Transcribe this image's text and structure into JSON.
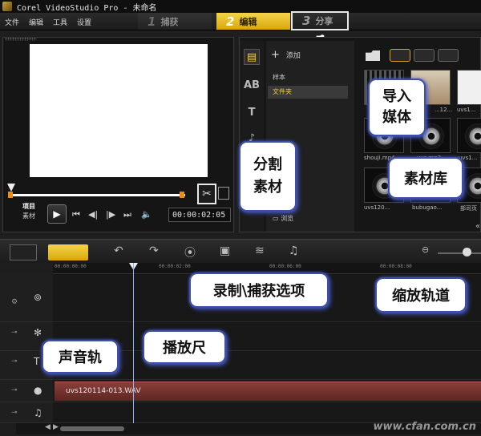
{
  "window": {
    "title": "Corel VideoStudio Pro - 未命名"
  },
  "menu": {
    "items": [
      "文件",
      "编辑",
      "工具",
      "设置"
    ]
  },
  "steps": [
    {
      "num": "1",
      "label": "捕获"
    },
    {
      "num": "2",
      "label": "编辑"
    },
    {
      "num": "3",
      "label": "分享"
    }
  ],
  "preview": {
    "mode_project": "项目",
    "mode_clip": "素材",
    "timecode": "00:00:02:05"
  },
  "library": {
    "add_label": "添加",
    "folders": [
      "样本",
      "文件夹"
    ],
    "browse_label": "浏览",
    "thumbs": [
      {
        "name": ""
      },
      {
        "name": "...12..."
      },
      {
        "name": "uvs1..."
      },
      {
        "name": "shouji.mp4"
      },
      {
        "name": "uvs.mp3"
      },
      {
        "name": "uvs1..."
      },
      {
        "name": "uvs120..."
      },
      {
        "name": "bubugao..."
      },
      {
        "name": "部司页"
      }
    ]
  },
  "timeline": {
    "ruler_labels": [
      "00:00:00:00",
      "00:00:02:00",
      "00:00:06:00",
      "00:00:08:00"
    ],
    "audio_clip": "uvs120114-013.WAV"
  },
  "callouts": {
    "import_media": "导入\n媒体",
    "split_clip": "分割\n素材",
    "library": "素材库",
    "record_capture": "录制\\捕获选项",
    "zoom_track": "缩放轨道",
    "scrubber": "播放尺",
    "voice_track": "声音轨"
  },
  "watermark": "www.cfan.com.cn"
}
